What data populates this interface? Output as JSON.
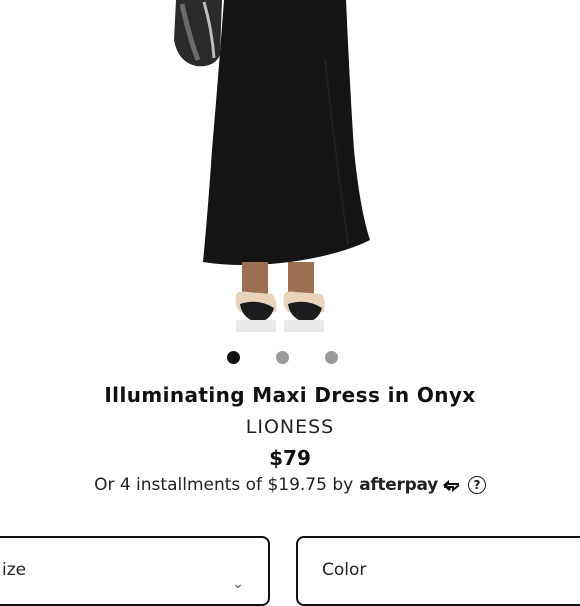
{
  "product": {
    "title": "Illuminating Maxi Dress in Onyx",
    "brand": "LIONESS",
    "price": "$79",
    "installments_text": "Or 4 installments of $19.75 by",
    "afterpay_label": "afterpay",
    "help_glyph": "?"
  },
  "carousel": {
    "active_index": 0,
    "count": 3
  },
  "selectors": {
    "size_label": "ize",
    "color_label": "Color"
  },
  "colors": {
    "dress": "#141414",
    "accent": "#000000",
    "dot_inactive": "#9a9a9a"
  },
  "icons": [
    "afterpay-icon",
    "help-circle-icon",
    "chevron-down-icon"
  ]
}
